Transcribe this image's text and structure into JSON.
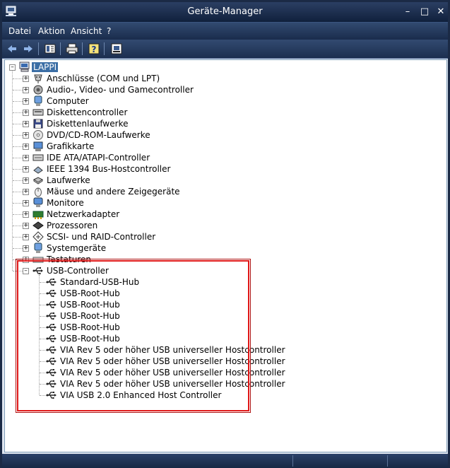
{
  "window": {
    "title": "Geräte-Manager"
  },
  "menu": [
    "Datei",
    "Aktion",
    "Ansicht",
    "?"
  ],
  "toolbar": [
    "back-icon",
    "forward-icon",
    "properties-view-icon",
    "print-icon",
    "help-icon",
    "scan-hardware-icon"
  ],
  "tree": {
    "root": "LAPPI",
    "categories": [
      "Anschlüsse (COM und LPT)",
      "Audio-, Video- und Gamecontroller",
      "Computer",
      "Diskettencontroller",
      "Diskettenlaufwerke",
      "DVD/CD-ROM-Laufwerke",
      "Grafikkarte",
      "IDE ATA/ATAPI-Controller",
      "IEEE 1394 Bus-Hostcontroller",
      "Laufwerke",
      "Mäuse und andere Zeigegeräte",
      "Monitore",
      "Netzwerkadapter",
      "Prozessoren",
      "SCSI- und RAID-Controller",
      "Systemgeräte",
      "Tastaturen"
    ],
    "expanded": {
      "label": "USB-Controller",
      "children": [
        "Standard-USB-Hub",
        "USB-Root-Hub",
        "USB-Root-Hub",
        "USB-Root-Hub",
        "USB-Root-Hub",
        "USB-Root-Hub",
        "VIA Rev 5 oder höher USB universeller Hostcontroller",
        "VIA Rev 5 oder höher USB universeller Hostcontroller",
        "VIA Rev 5 oder höher USB universeller Hostcontroller",
        "VIA Rev 5 oder höher USB universeller Hostcontroller",
        "VIA USB 2.0 Enhanced Host Controller"
      ]
    }
  },
  "colors": {
    "highlight_border": "#e01818",
    "titlebar": "#10203c"
  }
}
